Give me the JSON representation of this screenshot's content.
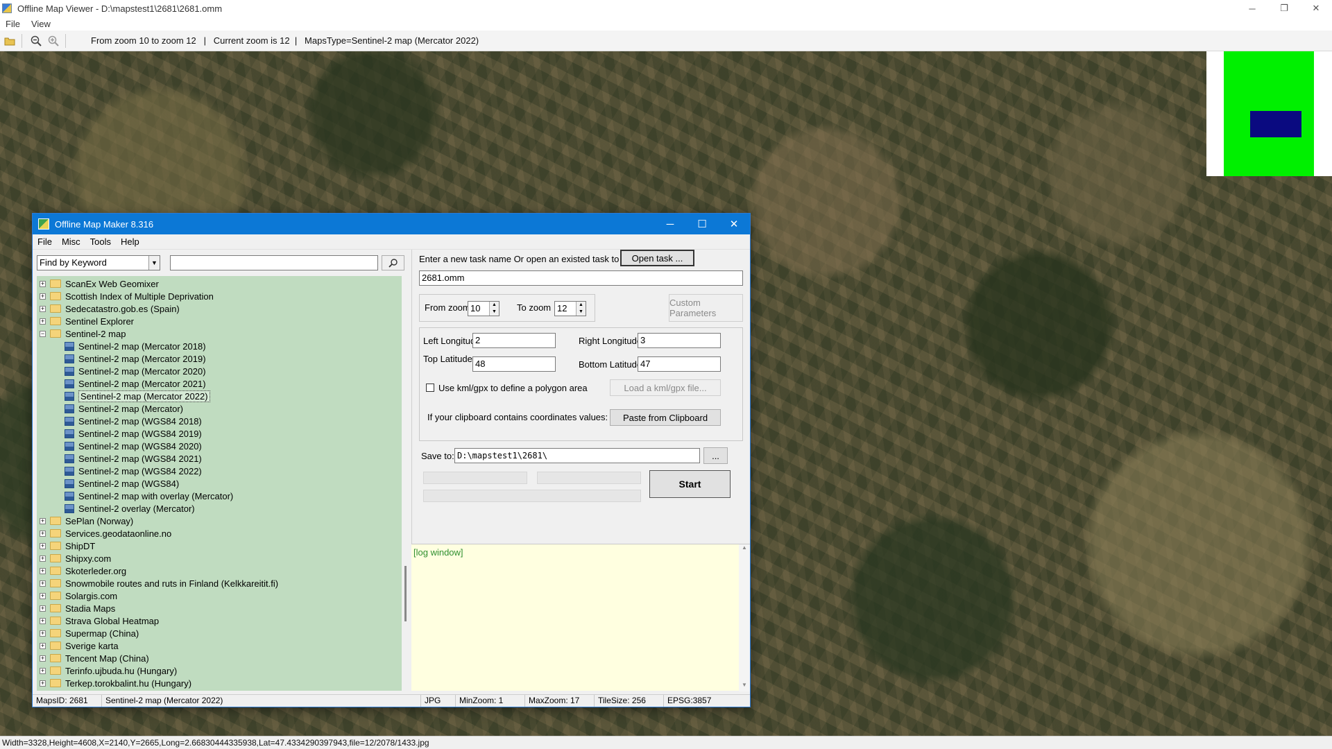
{
  "window": {
    "title": "Offline Map Viewer - D:\\mapstest1\\2681\\2681.omm",
    "controls": {
      "minimize": "─",
      "maximize": "❐",
      "close": "✕"
    }
  },
  "menu": [
    "File",
    "View"
  ],
  "toolbar": {
    "info": "From zoom 10 to zoom 12   |   Current zoom is 12  |   MapsType=Sentinel-2 map (Mercator 2022)"
  },
  "status": {
    "text": "Width=3328,Height=4608,X=2140,Y=2665,Long=2.66830444335938,Lat=47.4334290397943,file=12/2078/1433.jpg"
  },
  "minimap": {
    "colors": {
      "area": "#00f000",
      "viewport": "#0a0a80"
    }
  },
  "dialog": {
    "title": "Offline Map Maker 8.316",
    "controls": {
      "minimize": "─",
      "maximize": "☐",
      "close": "✕"
    },
    "menu": [
      "File",
      "Misc",
      "Tools",
      "Help"
    ],
    "search": {
      "mode": "Find by Keyword",
      "query": ""
    },
    "tree": [
      {
        "label": "ScanEx Web Geomixer",
        "level": 0,
        "kind": "folder",
        "expanded": false
      },
      {
        "label": "Scottish Index of Multiple Deprivation",
        "level": 0,
        "kind": "folder",
        "expanded": false
      },
      {
        "label": "Sedecatastro.gob.es (Spain)",
        "level": 0,
        "kind": "folder",
        "expanded": false
      },
      {
        "label": "Sentinel Explorer",
        "level": 0,
        "kind": "folder",
        "expanded": false
      },
      {
        "label": "Sentinel-2 map",
        "level": 0,
        "kind": "folder",
        "expanded": true
      },
      {
        "label": "Sentinel-2 map (Mercator 2018)",
        "level": 1,
        "kind": "map"
      },
      {
        "label": "Sentinel-2 map (Mercator 2019)",
        "level": 1,
        "kind": "map"
      },
      {
        "label": "Sentinel-2 map (Mercator 2020)",
        "level": 1,
        "kind": "map"
      },
      {
        "label": "Sentinel-2 map (Mercator 2021)",
        "level": 1,
        "kind": "map"
      },
      {
        "label": "Sentinel-2 map (Mercator 2022)",
        "level": 1,
        "kind": "map",
        "selected": true
      },
      {
        "label": "Sentinel-2 map (Mercator)",
        "level": 1,
        "kind": "map"
      },
      {
        "label": "Sentinel-2 map (WGS84 2018)",
        "level": 1,
        "kind": "map"
      },
      {
        "label": "Sentinel-2 map (WGS84 2019)",
        "level": 1,
        "kind": "map"
      },
      {
        "label": "Sentinel-2 map (WGS84 2020)",
        "level": 1,
        "kind": "map"
      },
      {
        "label": "Sentinel-2 map (WGS84 2021)",
        "level": 1,
        "kind": "map"
      },
      {
        "label": "Sentinel-2 map (WGS84 2022)",
        "level": 1,
        "kind": "map"
      },
      {
        "label": "Sentinel-2 map (WGS84)",
        "level": 1,
        "kind": "map"
      },
      {
        "label": "Sentinel-2 map with overlay (Mercator)",
        "level": 1,
        "kind": "map"
      },
      {
        "label": "Sentinel-2 overlay (Mercator)",
        "level": 1,
        "kind": "map"
      },
      {
        "label": "SePlan (Norway)",
        "level": 0,
        "kind": "folder",
        "expanded": false
      },
      {
        "label": "Services.geodataonline.no",
        "level": 0,
        "kind": "folder",
        "expanded": false
      },
      {
        "label": "ShipDT",
        "level": 0,
        "kind": "folder",
        "expanded": false
      },
      {
        "label": "Shipxy.com",
        "level": 0,
        "kind": "folder",
        "expanded": false
      },
      {
        "label": "Skoterleder.org",
        "level": 0,
        "kind": "folder",
        "expanded": false
      },
      {
        "label": "Snowmobile routes and ruts in Finland (Kelkkareitit.fi)",
        "level": 0,
        "kind": "folder",
        "expanded": false
      },
      {
        "label": "Solargis.com",
        "level": 0,
        "kind": "folder",
        "expanded": false
      },
      {
        "label": "Stadia Maps",
        "level": 0,
        "kind": "folder",
        "expanded": false
      },
      {
        "label": "Strava Global Heatmap",
        "level": 0,
        "kind": "folder",
        "expanded": false
      },
      {
        "label": "Supermap (China)",
        "level": 0,
        "kind": "folder",
        "expanded": false
      },
      {
        "label": "Sverige karta",
        "level": 0,
        "kind": "folder",
        "expanded": false
      },
      {
        "label": "Tencent Map (China)",
        "level": 0,
        "kind": "folder",
        "expanded": false
      },
      {
        "label": "Terinfo.ujbuda.hu (Hungary)",
        "level": 0,
        "kind": "folder",
        "expanded": false
      },
      {
        "label": "Terkep.torokbalint.hu (Hungary)",
        "level": 0,
        "kind": "folder",
        "expanded": false
      }
    ],
    "task": {
      "prompt": "Enter a new task name Or open an existed task to continue:",
      "open_button": "Open task ...",
      "name": "2681.omm"
    },
    "zoom": {
      "from_label": "From zoom",
      "from_value": "10",
      "to_label": "To zoom",
      "to_value": "12",
      "custom_button": "Custom Parameters"
    },
    "coords": {
      "left_label": "Left Longitude",
      "left_value": "2",
      "right_label": "Right Longitude",
      "right_value": "3",
      "top_label": "Top Latitude",
      "top_value": "48",
      "bottom_label": "Bottom Latitude",
      "bottom_value": "47",
      "kml_label": "Use kml/gpx to define a polygon area",
      "kml_checked": false,
      "kml_button": "Load a kml/gpx file...",
      "clipboard_label": "If your clipboard contains coordinates values:",
      "clipboard_button": "Paste from Clipboard"
    },
    "save": {
      "label": "Save to:",
      "path": "D:\\mapstest1\\2681\\",
      "browse": "..."
    },
    "start_button": "Start",
    "log": "[log window]",
    "statusbar": {
      "maps_id": "MapsID: 2681",
      "maps_name": "Sentinel-2 map (Mercator 2022)",
      "format": "JPG",
      "min_zoom": "MinZoom: 1",
      "max_zoom": "MaxZoom: 17",
      "tile_size": "TileSize: 256",
      "epsg": "EPSG:3857"
    }
  }
}
